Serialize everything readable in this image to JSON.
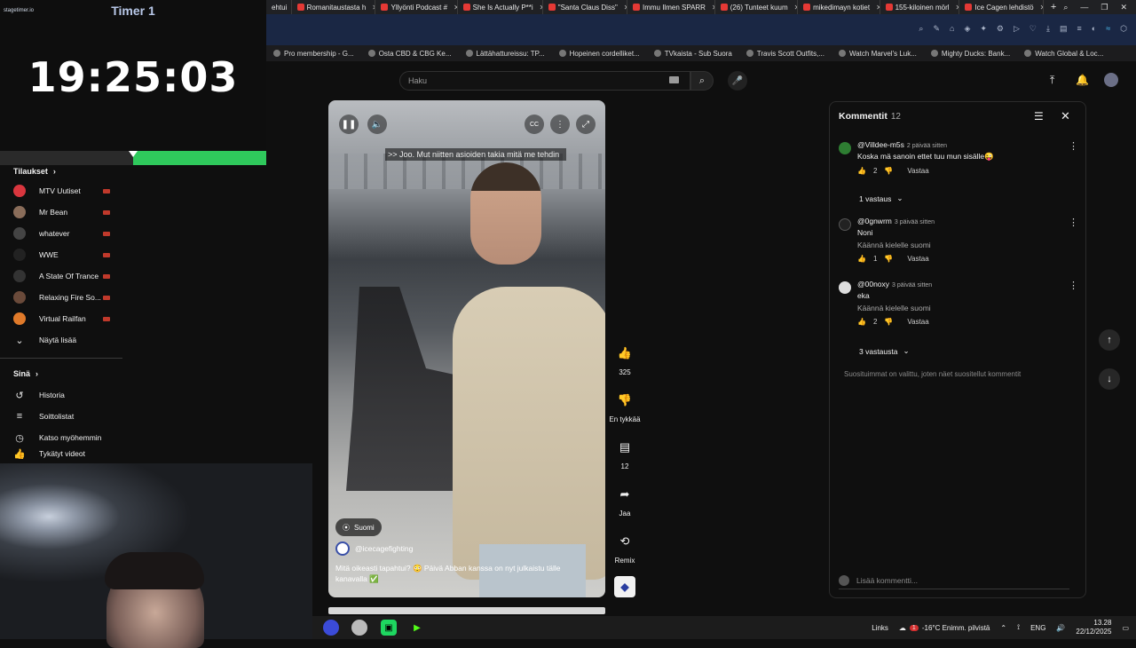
{
  "browser": {
    "tabs": [
      {
        "label": "ehtui"
      },
      {
        "label": "Romanitaustasta h"
      },
      {
        "label": "Yllyönti Podcast #"
      },
      {
        "label": "She Is Actually P**i"
      },
      {
        "label": "\"Santa Claus Diss\""
      },
      {
        "label": "Immu Ilmen SPARR"
      },
      {
        "label": "(26) Tunteet kuum"
      },
      {
        "label": "mikedimayn kotiet"
      },
      {
        "label": "155-kiloinen mörl"
      },
      {
        "label": "Ice Cagen lehdistö"
      }
    ],
    "new_tab": "+",
    "bookmarks": [
      "Pro membership - G...",
      "Osta CBD & CBG Ke...",
      "Lättähattureissu: TP...",
      "Hopeinen cordelliket...",
      "TVkaista - Sub Suora",
      "Travis Scott Outfits,...",
      "Watch Marvel's Luk...",
      "Mighty Ducks: Bank...",
      "Watch Global & Loc..."
    ]
  },
  "timer": {
    "logo": "stagetimer.io",
    "label": "Timer 1",
    "time": "19:25:03",
    "progress_fraction": 0.5,
    "color": "#2fc95c"
  },
  "sidebar": {
    "subscriptions_header": "Tilaukset",
    "subscriptions": [
      {
        "label": "MTV Uutiset",
        "color": "#d9363e"
      },
      {
        "label": "Mr Bean",
        "color": "#8a6d5a"
      },
      {
        "label": "whatever",
        "color": "#444"
      },
      {
        "label": "WWE",
        "color": "#222"
      },
      {
        "label": "A State Of Trance",
        "color": "#333"
      },
      {
        "label": "Relaxing Fire So...",
        "color": "#6a4a3a"
      },
      {
        "label": "Virtual Railfan",
        "color": "#e07a2a"
      }
    ],
    "show_more": "Näytä lisää",
    "you_header": "Sinä",
    "you_items": [
      {
        "label": "Historia",
        "icon": "history-icon"
      },
      {
        "label": "Soittolistat",
        "icon": "playlist-icon"
      },
      {
        "label": "Katso myöhemmin",
        "icon": "clock-icon"
      },
      {
        "label": "Tykätyt videot",
        "icon": "like-icon"
      }
    ]
  },
  "search": {
    "placeholder": "Haku"
  },
  "video": {
    "caption": ">> Joo. Mut niitten asioiden takia mitä me tehdin",
    "location": "Suomi",
    "channel": "@icecagefighting",
    "description": "Mitä oikeasti tapahtui? 😳 Päivä Abban kanssa on nyt julkaistu tälle kanavalla ✅",
    "cc_label": "CC"
  },
  "actions": {
    "likes": "325",
    "dislike": "En tykkää",
    "comments": "12",
    "share": "Jaa",
    "remix": "Remix"
  },
  "comments": {
    "title": "Kommentit",
    "count": "12",
    "items": [
      {
        "author": "@Villdee-m5s",
        "ago": "2 päivää sitten",
        "text": "Koska mä sanoin ettet tuu mun sisälle😜",
        "translate": "",
        "likes": "2",
        "reply": "Vastaa",
        "avatar_color": "#2e7d32"
      },
      {
        "author": "@0gnwrm",
        "ago": "3 päivää sitten",
        "text": "Noni",
        "translate": "Käännä kielelle suomi",
        "likes": "1",
        "reply": "Vastaa",
        "avatar_color": "#222"
      },
      {
        "author": "@00noxy",
        "ago": "3 päivää sitten",
        "text": "eka",
        "translate": "Käännä kielelle suomi",
        "likes": "2",
        "reply": "Vastaa",
        "avatar_color": "#ddd"
      }
    ],
    "replies_1": "1 vastaus",
    "replies_3": "3 vastausta",
    "note": "Suosituimmat on valittu, joten näet suositellut kommentit",
    "add_placeholder": "Lisää kommentti..."
  },
  "taskbar": {
    "links": "Links",
    "weather": "-16°C  Enimm. pilvistä",
    "lang": "ENG",
    "time": "13.28",
    "date": "22/12/2025",
    "notification_count": "1"
  }
}
